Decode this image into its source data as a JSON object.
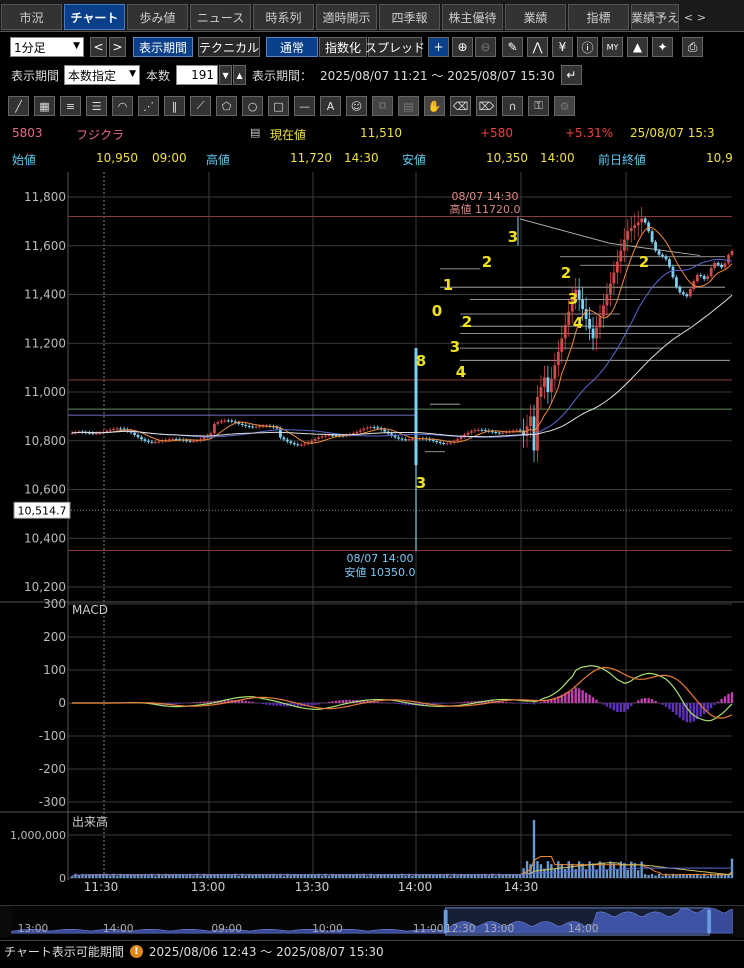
{
  "tabs": [
    {
      "label": "市況",
      "active": false
    },
    {
      "label": "チャート",
      "active": true
    },
    {
      "label": "歩み値",
      "active": false
    },
    {
      "label": "ニュース",
      "active": false
    },
    {
      "label": "時系列",
      "active": false
    },
    {
      "label": "適時開示",
      "active": false
    },
    {
      "label": "四季報",
      "active": false
    },
    {
      "label": "株主優待",
      "active": false
    },
    {
      "label": "業績",
      "active": false
    },
    {
      "label": "指標",
      "active": false
    },
    {
      "label": "業績予え",
      "active": false
    }
  ],
  "toolbar1": {
    "interval": "1分足",
    "display_period_label": "表示期間",
    "technical_label": "テクニカル",
    "normal_label": "通常",
    "index_label": "指数化",
    "spread_label": "スプレッド"
  },
  "toolbar2": {
    "period_label": "表示期間",
    "period_mode": "本数指定",
    "count_label": "本数",
    "count_value": "191",
    "range_label": "表示期間：",
    "range_value": "2025/08/07 11:21 ～ 2025/08/07 15:30"
  },
  "quote": {
    "code": "5803",
    "name": "フジクラ",
    "current_label": "現在値",
    "current_value": "11,510",
    "change": "+580",
    "change_pct": "+5.31%",
    "datetime": "25/08/07  15:3",
    "open_label": "始値",
    "open_value": "10,950",
    "open_time": "09:00",
    "high_label": "高値",
    "high_value": "11,720",
    "high_time": "14:30",
    "low_label": "安値",
    "low_value": "10,350",
    "low_time": "14:00",
    "prev_close_label": "前日終値",
    "prev_close_value": "10,9"
  },
  "chart_data": {
    "type": "candlestick",
    "price_axis": {
      "ticks": [
        "11,800",
        "11,600",
        "11,400",
        "11,200",
        "11,000",
        "10,800",
        "10,600",
        "10,400",
        "10,200"
      ],
      "min": 10200,
      "max": 11800
    },
    "cursor_price": "10,514.7",
    "time_labels": [
      "11:30",
      "13:00",
      "13:30",
      "14:00",
      "14:30"
    ],
    "high_annotation": {
      "time": "08/07 14:30",
      "label": "高値 11720.0"
    },
    "low_annotation": {
      "time": "08/07 14:00",
      "label": "安値 10350.0"
    },
    "count_labels": [
      "8",
      "3",
      "0",
      "1",
      "3",
      "4",
      "2",
      "2",
      "3",
      "2",
      "3",
      "4",
      "2"
    ],
    "reference_lines": [
      11720,
      11050,
      10930,
      10350
    ],
    "macd": {
      "label": "MACD",
      "ticks": [
        "300",
        "200",
        "100",
        "0",
        "-100",
        "-200",
        "-300"
      ],
      "min": -300,
      "max": 300
    },
    "volume": {
      "label": "出来高",
      "ticks": [
        "1,000,000",
        "0"
      ]
    },
    "colors": {
      "up": "#d14a4a",
      "down": "#7fd0f0",
      "ma_short": "#f08a3a",
      "ma_mid": "#5a6ad0",
      "ma_long": "#e0e0e0",
      "macd": "#a8e070",
      "signal": "#e87a3a",
      "hist_pos": "#c040b0",
      "hist_neg": "#6030c0",
      "count": "#f0e020",
      "grid": "#3a3a3a"
    }
  },
  "navigator": {
    "labels": [
      "13:00",
      "14:00",
      "09:00",
      "10:00",
      "11:00",
      "12:30",
      "13:00",
      "14:00"
    ]
  },
  "footer": {
    "label": "チャート表示可能期間",
    "range": "2025/08/06 12:43 ～ 2025/08/07 15:30"
  }
}
